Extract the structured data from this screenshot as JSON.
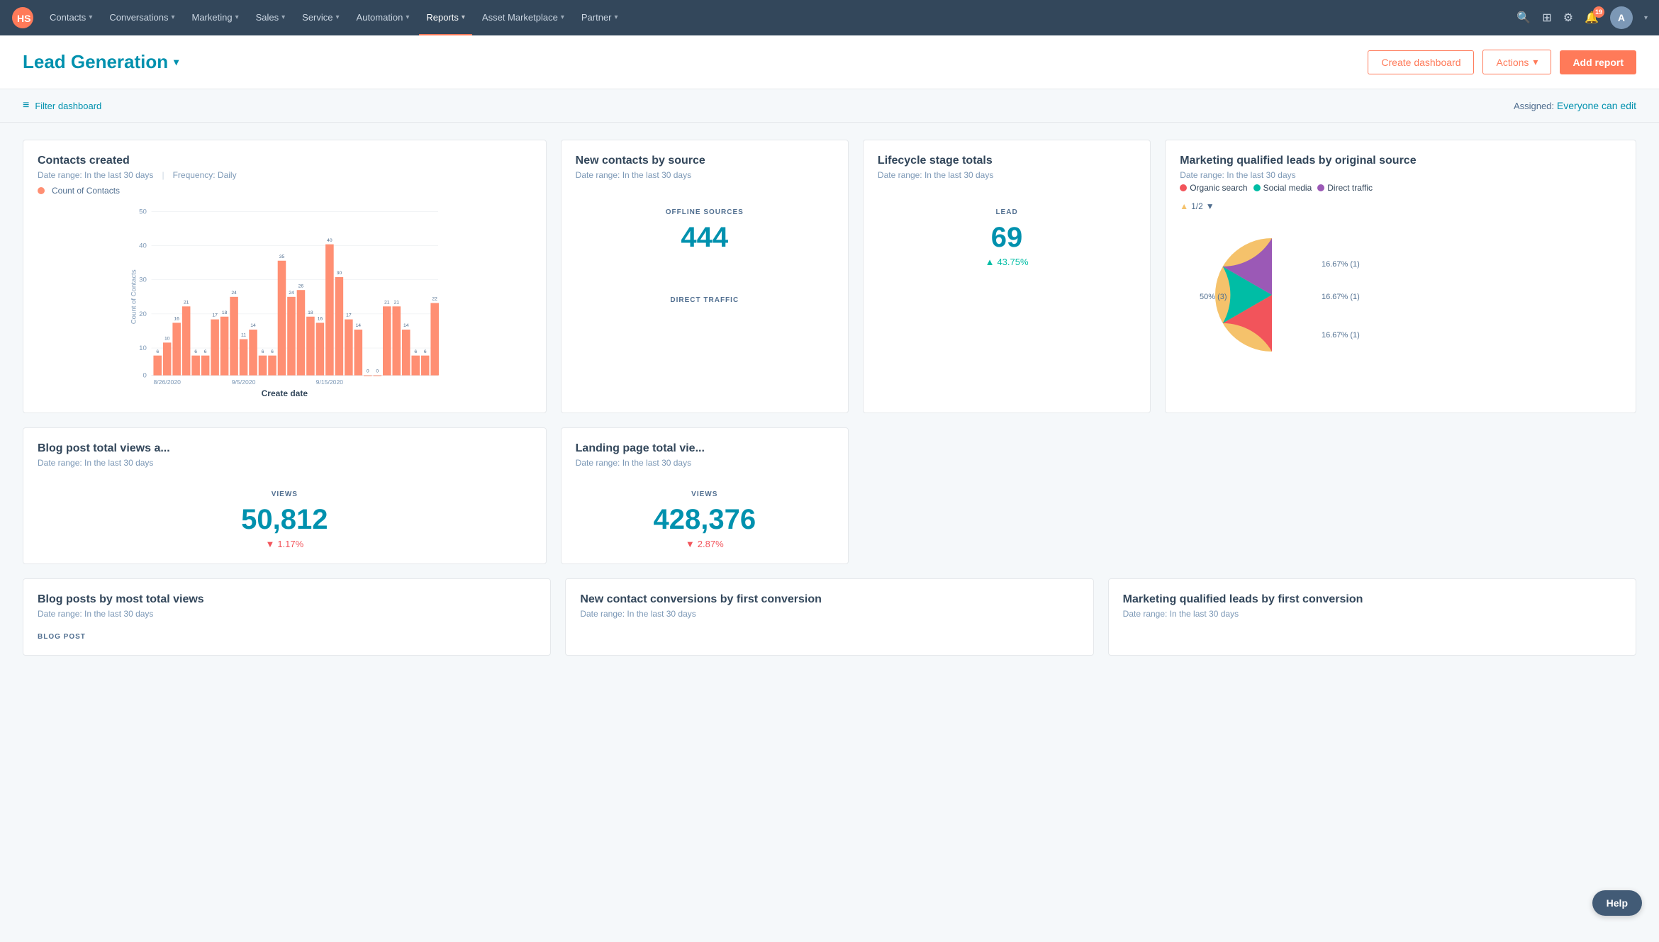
{
  "nav": {
    "items": [
      {
        "label": "Contacts",
        "id": "contacts"
      },
      {
        "label": "Conversations",
        "id": "conversations"
      },
      {
        "label": "Marketing",
        "id": "marketing"
      },
      {
        "label": "Sales",
        "id": "sales"
      },
      {
        "label": "Service",
        "id": "service"
      },
      {
        "label": "Automation",
        "id": "automation"
      },
      {
        "label": "Reports",
        "id": "reports",
        "active": true
      },
      {
        "label": "Asset Marketplace",
        "id": "asset-marketplace"
      },
      {
        "label": "Partner",
        "id": "partner"
      }
    ],
    "notification_count": "19"
  },
  "header": {
    "title": "Lead Generation",
    "create_dashboard_label": "Create dashboard",
    "actions_label": "Actions",
    "add_report_label": "Add report"
  },
  "toolbar": {
    "filter_label": "Filter dashboard",
    "assigned_label": "Assigned:",
    "assigned_value": "Everyone can edit"
  },
  "cards": {
    "contacts_created": {
      "title": "Contacts created",
      "date_range": "Date range: In the last 30 days",
      "frequency": "Frequency: Daily",
      "legend": "Count of Contacts",
      "x_label": "Create date",
      "y_label": "Count of Contacts",
      "dates": [
        "8/26/2020",
        "9/5/2020",
        "9/15/2020"
      ],
      "bars": [
        6,
        10,
        16,
        21,
        6,
        6,
        17,
        18,
        24,
        11,
        14,
        6,
        6,
        35,
        24,
        26,
        18,
        16,
        40,
        30,
        17,
        14,
        0,
        0,
        21,
        21,
        14,
        6,
        6,
        22
      ],
      "y_ticks": [
        0,
        10,
        20,
        30,
        40,
        50
      ]
    },
    "new_contacts_by_source": {
      "title": "New contacts by source",
      "date_range": "Date range: In the last 30 days",
      "offline_label": "OFFLINE SOURCES",
      "offline_value": "444",
      "direct_label": "DIRECT TRAFFIC",
      "direct_value": ""
    },
    "lifecycle_stage": {
      "title": "Lifecycle stage totals",
      "date_range": "Date range: In the last 30 days",
      "lead_label": "LEAD",
      "lead_value": "69",
      "lead_change": "43.75%",
      "lead_direction": "up"
    },
    "mql_by_source": {
      "title": "Marketing qualified leads by original source",
      "date_range": "Date range: In the last 30 days",
      "legend": [
        {
          "label": "Organic search",
          "color": "#f2545b"
        },
        {
          "label": "Social media",
          "color": "#00bda5"
        },
        {
          "label": "Direct traffic",
          "color": "#9b59b6"
        }
      ],
      "page": "1/2",
      "slices": [
        {
          "label": "50% (3)",
          "value": 50,
          "color": "#f5c26b",
          "position": "left"
        },
        {
          "label": "16.67% (1)",
          "value": 16.67,
          "color": "#f2545b",
          "position": "top-right"
        },
        {
          "label": "16.67% (1)",
          "value": 16.67,
          "color": "#00bda5",
          "position": "right"
        },
        {
          "label": "16.67% (1)",
          "value": 16.67,
          "color": "#9b59b6",
          "position": "bottom-right"
        }
      ]
    },
    "blog_post_views": {
      "title": "Blog post total views a...",
      "date_range": "Date range: In the last 30 days",
      "views_label": "VIEWS",
      "views_value": "50,812",
      "change": "1.17%",
      "direction": "down"
    },
    "landing_page_views": {
      "title": "Landing page total vie...",
      "date_range": "Date range: In the last 30 days",
      "views_label": "VIEWS",
      "views_value": "428,376",
      "change": "2.87%",
      "direction": "down"
    },
    "blog_posts_top_views": {
      "title": "Blog posts by most total views",
      "date_range": "Date range: In the last 30 days",
      "sub_label": "BLOG POST"
    },
    "new_contact_conversions": {
      "title": "New contact conversions by first conversion",
      "date_range": "Date range: In the last 30 days"
    },
    "mql_first_conversion": {
      "title": "Marketing qualified leads by first conversion",
      "date_range": "Date range: In the last 30 days"
    }
  },
  "help": {
    "label": "Help"
  }
}
